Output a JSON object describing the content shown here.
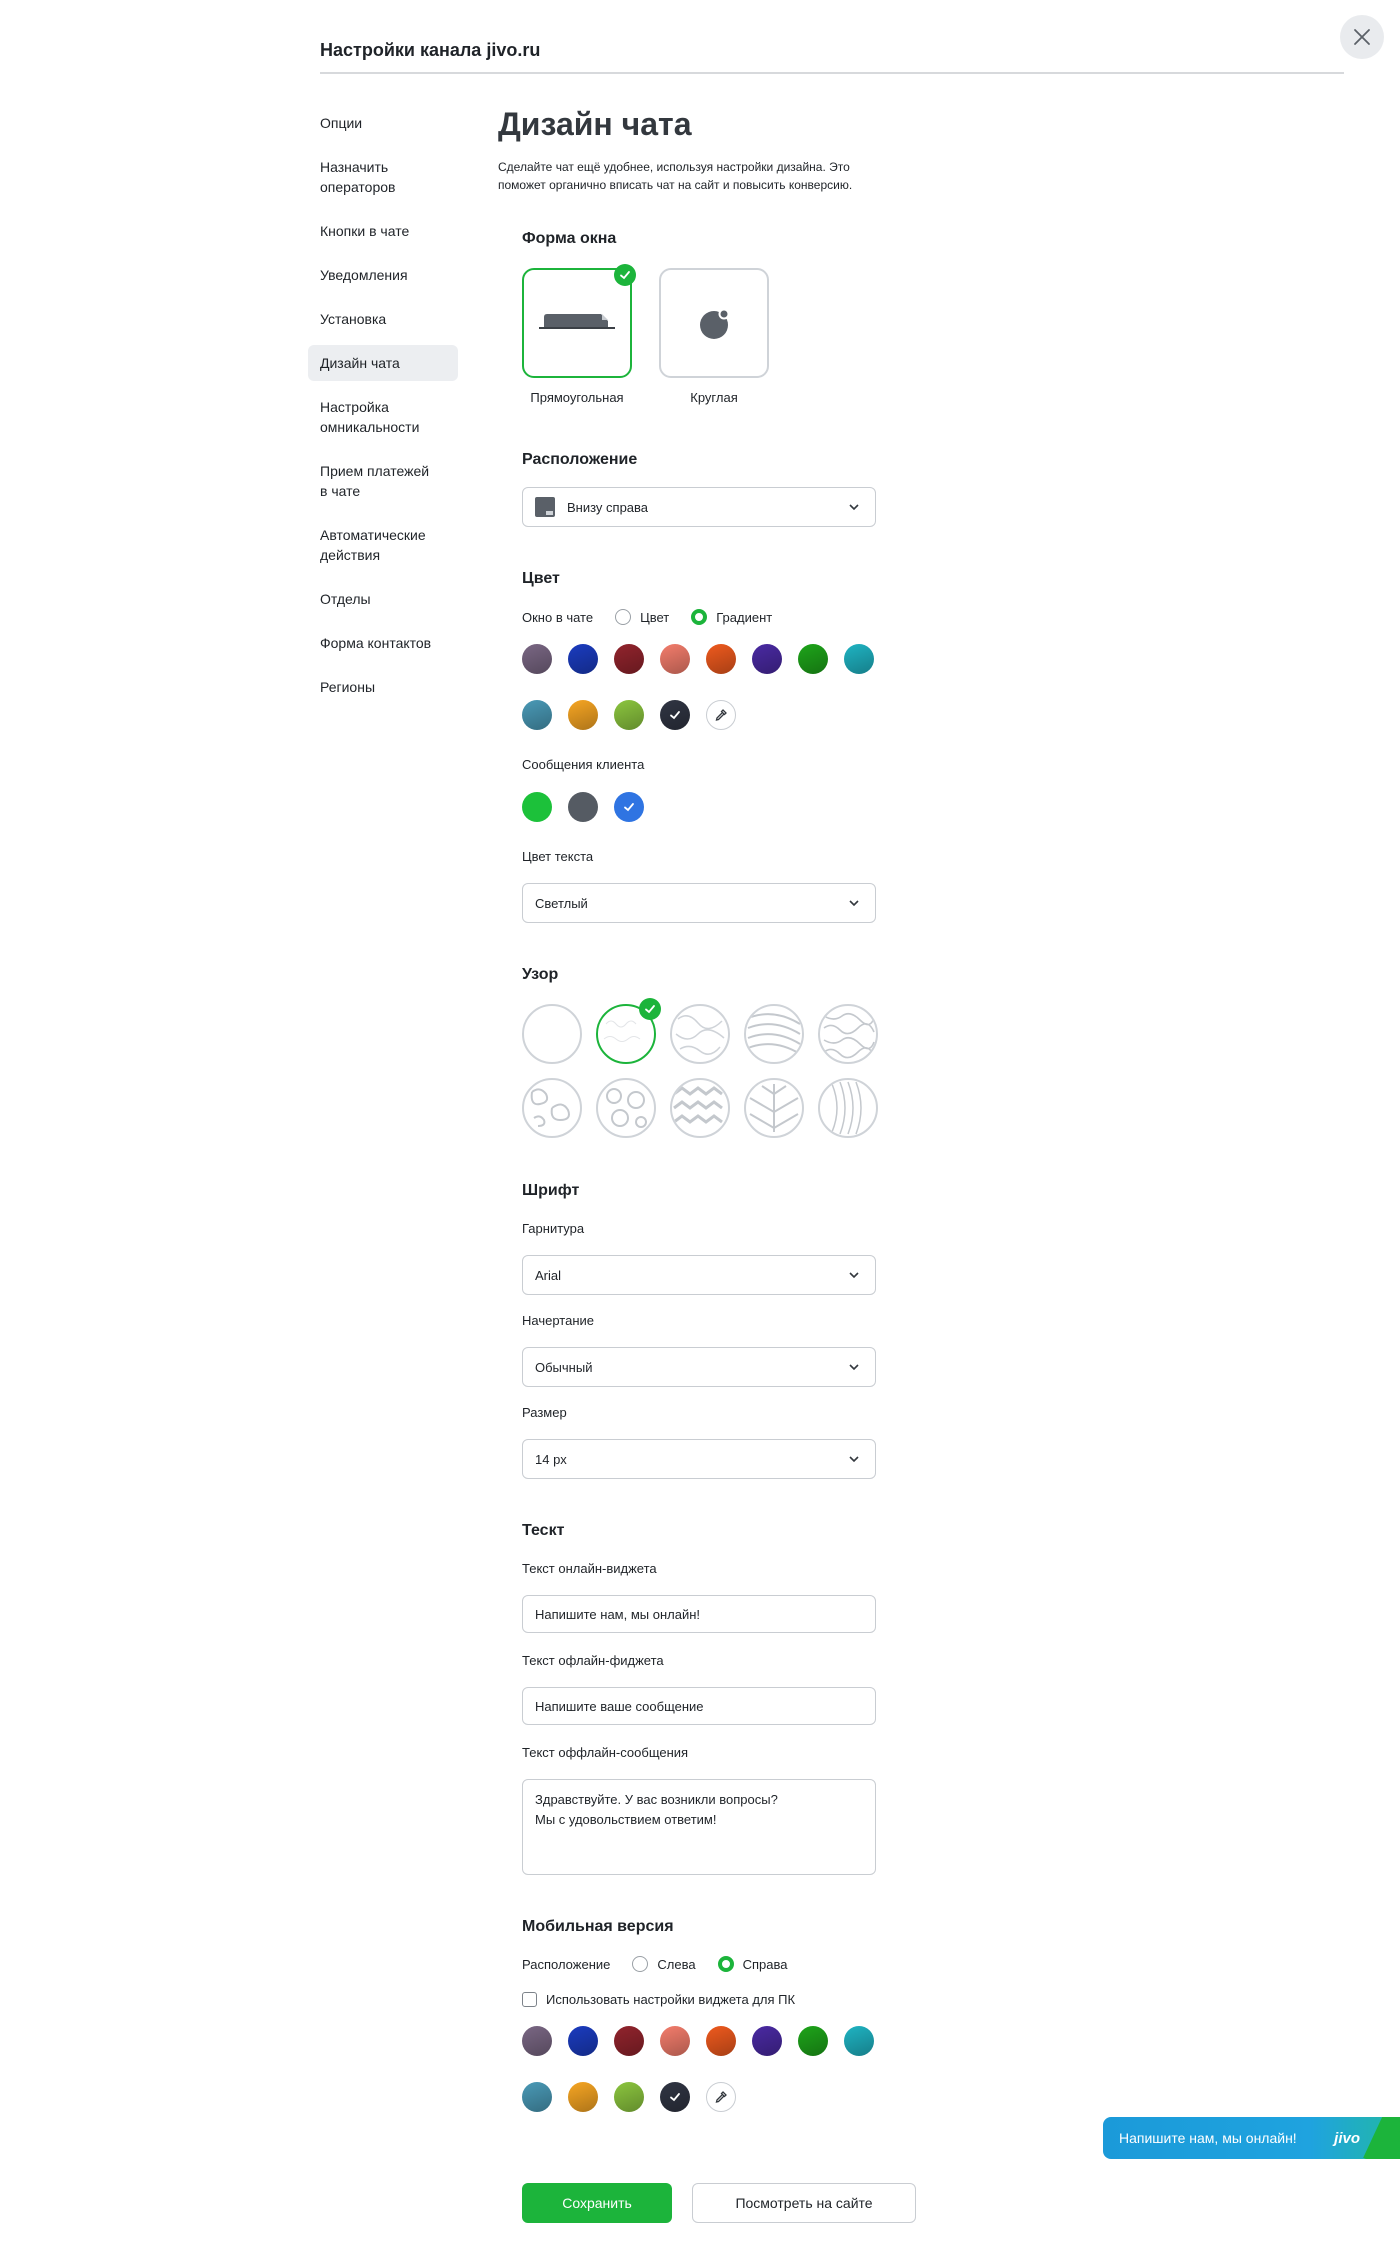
{
  "header": {
    "title": "Настройки канала jivo.ru"
  },
  "sidebar": {
    "items": [
      {
        "label": "Опции"
      },
      {
        "label": "Назначить\nоператоров"
      },
      {
        "label": "Кнопки в чате"
      },
      {
        "label": "Уведомления"
      },
      {
        "label": "Установка"
      },
      {
        "label": "Дизайн чата"
      },
      {
        "label": "Настройка\nомникальности"
      },
      {
        "label": "Прием платежей\nв чате"
      },
      {
        "label": "Автоматические\nдействия"
      },
      {
        "label": "Отделы"
      },
      {
        "label": "Форма контактов"
      },
      {
        "label": "Регионы"
      }
    ],
    "active_index": 5
  },
  "main": {
    "title": "Дизайн чата",
    "description": "Сделайте чат ещё удобнее, используя настройки дизайна. Это поможет органично вписать чат на сайт и повысить конверсию."
  },
  "window_shape": {
    "title": "Форма окна",
    "options": [
      {
        "label": "Прямоугольная",
        "selected": true
      },
      {
        "label": "Круглая",
        "selected": false
      }
    ]
  },
  "position": {
    "title": "Расположение",
    "value": "Внизу справа"
  },
  "color": {
    "title": "Цвет",
    "window_label": "Окно в чате",
    "radio_color": "Цвет",
    "radio_gradient": "Градиент",
    "selected_mode": "Градиент",
    "swatches": [
      {
        "color": "#7a6784"
      },
      {
        "color": "#1b3cc0"
      },
      {
        "color": "#92242d"
      },
      {
        "color": "#f47d6c"
      },
      {
        "color": "#ef5a1e"
      },
      {
        "color": "#4a2aa3"
      },
      {
        "color": "#1ea51a"
      },
      {
        "color": "#1fb4c3"
      },
      {
        "color": "#4a9ab7"
      },
      {
        "color": "#f7a623"
      },
      {
        "color": "#8cc63f"
      },
      {
        "color": "#303543",
        "selected": true
      },
      {
        "color": "eyedropper"
      }
    ],
    "client_messages_label": "Сообщения клиента",
    "client_swatches": [
      {
        "color": "#1cc13a"
      },
      {
        "color": "#555b63"
      },
      {
        "color": "#2f74e2",
        "selected": true
      }
    ],
    "text_color_label": "Цвет текста",
    "text_color_value": "Светлый"
  },
  "pattern": {
    "title": "Узор",
    "count": 10,
    "selected_index": 1
  },
  "font": {
    "title": "Шрифт",
    "family_label": "Гарнитура",
    "family_value": "Arial",
    "style_label": "Начертание",
    "style_value": "Обычный",
    "size_label": "Размер",
    "size_value": "14 px"
  },
  "text": {
    "title": "Тескт",
    "online_label": "Текст онлайн-виджета",
    "online_value": "Напишите нам, мы онлайн!",
    "offline_label": "Текст офлайн-фиджета",
    "offline_value": "Напишите ваше сообщение",
    "offline_msg_label": "Текст оффлайн-сообщения",
    "offline_msg_value": "Здравствуйте. У вас возникли вопросы?\nМы с удовольствием ответим!"
  },
  "mobile": {
    "title": "Мобильная версия",
    "position_label": "Расположение",
    "left_label": "Слева",
    "right_label": "Справа",
    "selected": "Справа",
    "checkbox_label": "Использовать настройки виджета для ПК",
    "checkbox_checked": false
  },
  "buttons": {
    "save": "Сохранить",
    "view": "Посмотреть на сайте"
  },
  "widget": {
    "text": "Напишите нам, мы онлайн!",
    "logo": "jivo"
  }
}
